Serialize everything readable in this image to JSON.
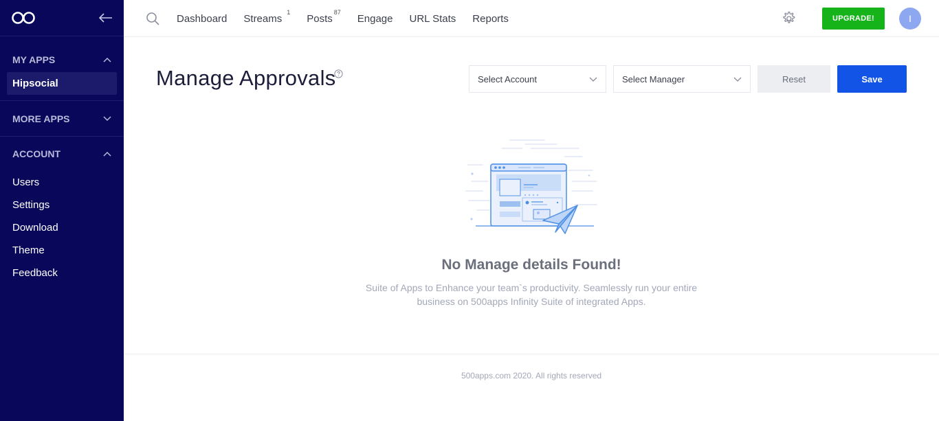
{
  "sidebar": {
    "sections": {
      "my_apps": {
        "label": "MY APPS",
        "items": [
          "Hipsocial"
        ]
      },
      "more_apps": {
        "label": "MORE APPS"
      },
      "account": {
        "label": "ACCOUNT",
        "items": [
          "Users",
          "Settings",
          "Download",
          "Theme",
          "Feedback"
        ]
      }
    }
  },
  "topbar": {
    "nav": [
      {
        "label": "Dashboard"
      },
      {
        "label": "Streams",
        "badge": "1"
      },
      {
        "label": "Posts",
        "badge": "87"
      },
      {
        "label": "Engage"
      },
      {
        "label": "URL Stats"
      },
      {
        "label": "Reports"
      }
    ],
    "upgrade_label": "UPGRADE!",
    "avatar_initial": "I"
  },
  "main": {
    "title": "Manage Approvals",
    "select_account_placeholder": "Select Account",
    "select_manager_placeholder": "Select Manager",
    "reset_label": "Reset",
    "save_label": "Save",
    "empty_title": "No Manage details Found!",
    "empty_desc": "Suite of Apps to Enhance your team`s productivity. Seamlessly run your entire business on 500apps Infinity Suite of integrated Apps."
  },
  "footer": {
    "text": "500apps.com 2020. All rights reserved"
  },
  "colors": {
    "sidebar_bg": "#08075a",
    "upgrade_green": "#17b31b",
    "save_blue": "#1254e6",
    "avatar_bg": "#8ea7f1"
  }
}
